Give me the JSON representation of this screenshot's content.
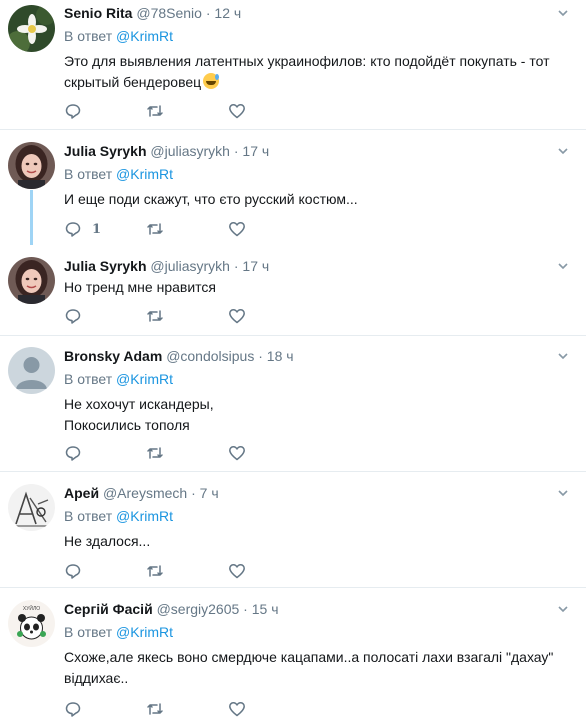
{
  "colors": {
    "accent": "#1b95e0",
    "muted": "#657786",
    "border": "#e6ecf0",
    "thread": "#9fd4f5"
  },
  "tweets": [
    {
      "name": "Senio Rita",
      "handle": "@78Senio",
      "dot": "·",
      "time": "12 ч",
      "reply_prefix": "В ответ",
      "reply_to": "@KrimRt",
      "text": "Это для выявления латентных украинофилов: кто подойдёт покупать - тот скрытый бендеровец",
      "emoji": "smiling-face-with-sweat",
      "avatar": "flower-avatar",
      "reply_count": ""
    },
    {
      "name": "Julia Syrykh",
      "handle": "@juliasyrykh",
      "dot": "·",
      "time": "17 ч",
      "reply_prefix": "В ответ",
      "reply_to": "@KrimRt",
      "text": "И еще поди скажут, что єто русский костюм...",
      "avatar": "woman-portrait-avatar",
      "reply_count": "1"
    },
    {
      "name": "Julia Syrykh",
      "handle": "@juliasyrykh",
      "dot": "·",
      "time": "17 ч",
      "text": "Но тренд мне нравится",
      "avatar": "woman-portrait-avatar",
      "reply_count": ""
    },
    {
      "name": "Bronsky Adam",
      "handle": "@condolsipus",
      "dot": "·",
      "time": "18 ч",
      "reply_prefix": "В ответ",
      "reply_to": "@KrimRt",
      "text_lines": [
        "Не хохочут искандеры,",
        "Покосились тополя"
      ],
      "avatar": "default-avatar",
      "reply_count": ""
    },
    {
      "name": "Арей",
      "handle": "@Areysmech",
      "dot": "·",
      "time": "7 ч",
      "reply_prefix": "В ответ",
      "reply_to": "@KrimRt",
      "text": "Не здалося...",
      "avatar": "sketch-avatar",
      "reply_count": ""
    },
    {
      "name": "Сергій Фасій",
      "handle": "@sergiy2605",
      "dot": "·",
      "time": "15 ч",
      "reply_prefix": "В ответ",
      "reply_to": "@KrimRt",
      "text": "Схоже,але якесь воно смердюче кацапами..а полосаті лахи взагалі \"дахау\" віддихає..",
      "avatar": "panda-avatar",
      "avatar_caption": "ХУЙЛО",
      "reply_count": ""
    }
  ]
}
